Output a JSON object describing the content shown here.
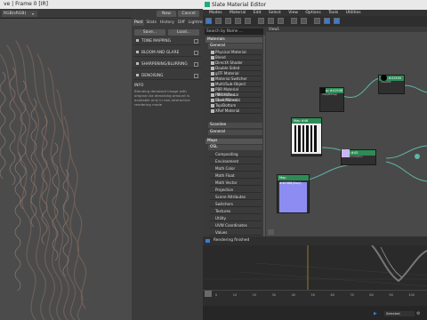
{
  "frame_buffer": {
    "title": "ve | Frame 0 [IR]",
    "channel": "RGB(sRGB)",
    "toolbar": {
      "btn_now": "Now",
      "btn_cancel": "Cancel"
    },
    "tabs": [
      "Post",
      "Stats",
      "History",
      "Diff",
      "Lightmix"
    ],
    "save_btn": "Save...",
    "load_btn": "Load...",
    "sections": [
      "TONE MAPPING",
      "BLOOM AND GLARE",
      "SHARPENING/BLURRING",
      "DENOISING"
    ],
    "info_label": "INFO",
    "info_text": "Blending denoised image with original via denoising amount is available only in non-interactive rendering mode"
  },
  "slate": {
    "title": "Slate Material Editor",
    "menu": [
      "Modes",
      "Material",
      "Edit",
      "Select",
      "View",
      "Options",
      "Tools",
      "Utilities"
    ],
    "view_tab": "View1",
    "search_placeholder": "Search by Name ...",
    "materials_header": "Materials",
    "general_header": "General",
    "materials": [
      "Physical Material",
      "Blend",
      "DirectX Shader",
      "Double Sided",
      "glTF Material",
      "Material Switcher",
      "Multi/Sub-Object",
      "PBR Material (Metal/Rou...",
      "PBR Material (Spec/Gloss)",
      "Shell Material",
      "Top/Bottom",
      "XRef Material"
    ],
    "scanline_header": "Scanline",
    "general2_header": "General",
    "maps_header": "Maps",
    "osl_header": "OSL",
    "maps": [
      "Compositing",
      "Environment",
      "Math Color",
      "Math Float",
      "Math Vector",
      "Projection",
      "Scene Attributes",
      "Switchers",
      "Textures",
      "Utility",
      "UVW Coordinates",
      "Values"
    ],
    "status": "Rendering finished",
    "nodes": {
      "map1": {
        "title": "Map #41948",
        "sub": "VRayBitmap"
      },
      "map2": {
        "title": "Map #41945",
        "sub": "VRayMtl"
      },
      "map3": {
        "title": "Map #46",
        "sub": "Bitmap"
      },
      "map4": {
        "title": "Map #43",
        "sub": "ColorCorrection"
      },
      "map5": {
        "title": "Map #40968(Hair)",
        "sub": "Bitmap"
      }
    }
  },
  "timeline": {
    "ticks": [
      "0",
      "10",
      "20",
      "30",
      "40",
      "50",
      "60",
      "70",
      "80",
      "90",
      "100"
    ],
    "selected": "Selected"
  }
}
